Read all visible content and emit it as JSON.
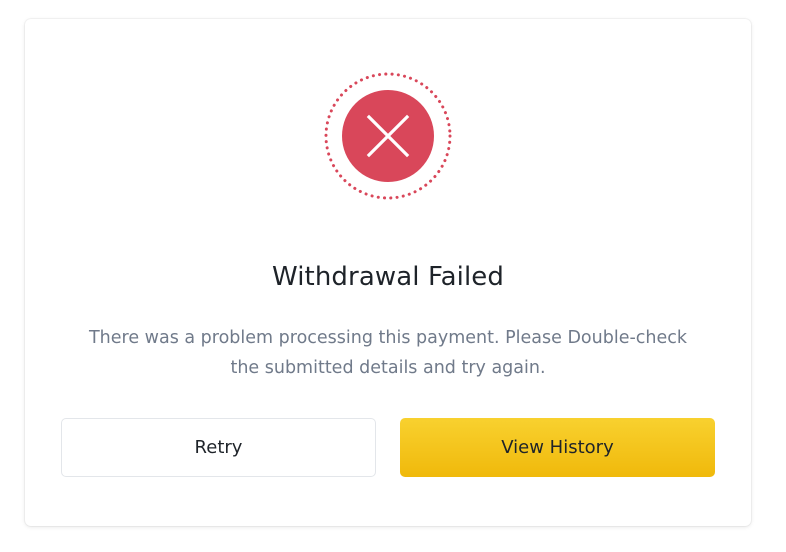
{
  "dialog": {
    "title": "Withdrawal Failed",
    "message_line1": "There was a problem processing this payment. Please Double-check",
    "message_line2": "the submitted details and try again.",
    "status_icon": "close-x-icon",
    "colors": {
      "error": "#d9475a",
      "primary": "#f0b90b",
      "text": "#1e2329",
      "muted": "#707a8a"
    }
  },
  "actions": {
    "retry_label": "Retry",
    "view_history_label": "View History"
  }
}
